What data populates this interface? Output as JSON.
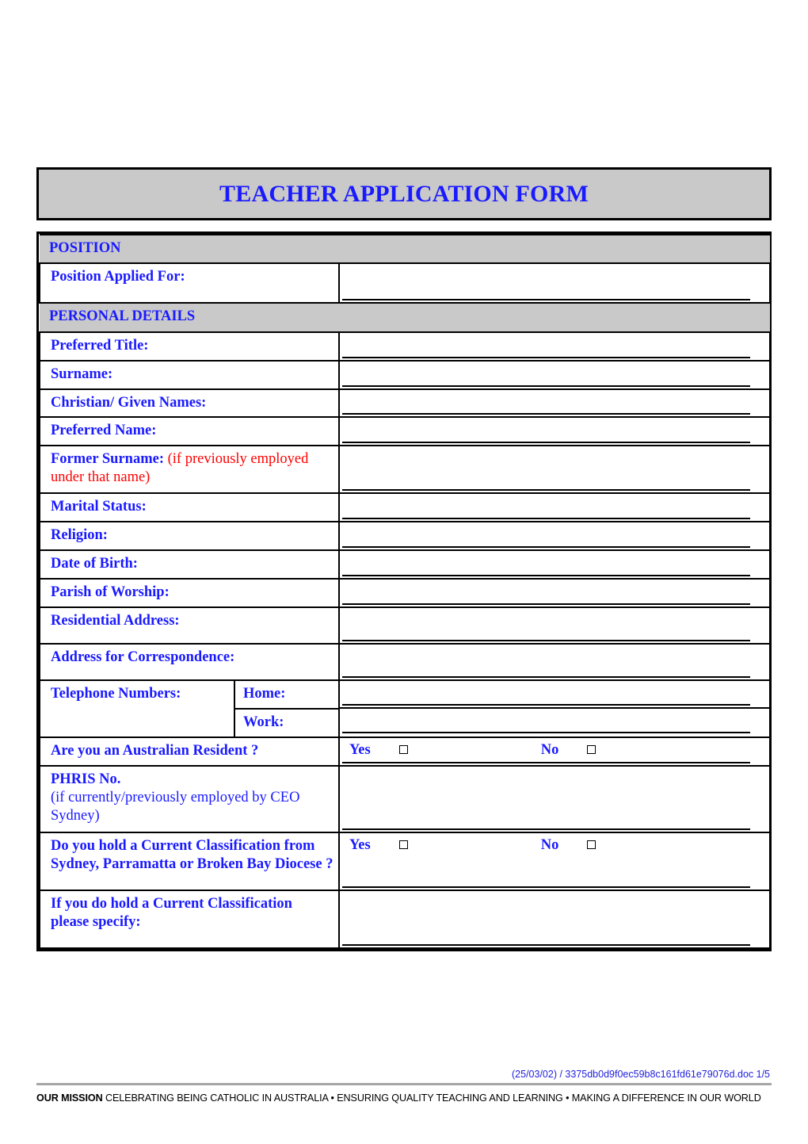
{
  "document": {
    "title": "TEACHER APPLICATION FORM"
  },
  "sections": {
    "position": {
      "band_label": "POSITION",
      "fields": [
        {
          "label": "Position Applied For:",
          "value": ""
        }
      ]
    },
    "personal_details": {
      "band_label": "PERSONAL DETAILS",
      "fields": [
        {
          "label": "Preferred Title:",
          "value": ""
        },
        {
          "label": "Surname:",
          "value": ""
        },
        {
          "label": "Christian/ Given Names:",
          "value": ""
        },
        {
          "label": "Preferred Name:",
          "value": ""
        },
        {
          "label": "Former Surname:",
          "note": "(if previously employed under that name)",
          "value": ""
        },
        {
          "label": "Marital Status:",
          "value": ""
        },
        {
          "label": "Religion:",
          "value": ""
        },
        {
          "label": "Date of Birth:",
          "value": ""
        },
        {
          "label": "Parish of Worship:",
          "value": ""
        },
        {
          "label": "Residential Address:",
          "value": ""
        },
        {
          "label": "Address for Correspondence:",
          "value": ""
        }
      ],
      "telephone": {
        "label": "Telephone Numbers:",
        "rows": [
          {
            "label": "Home:",
            "value": ""
          },
          {
            "label": "Work:",
            "value": ""
          }
        ]
      },
      "australian_resident": {
        "label": "Are you an Australian Resident ?",
        "yes_label": "Yes",
        "no_label": "No",
        "yes_checked": false,
        "no_checked": false
      },
      "phris": {
        "label": "PHRIS No.",
        "note": "(if currently/previously employed by CEO Sydney)",
        "value": ""
      },
      "current_classification": {
        "label": "Do you hold a Current Classification from Sydney, Parramatta or Broken Bay Diocese ?",
        "yes_label": "Yes",
        "no_label": "No",
        "yes_checked": false,
        "no_checked": false
      },
      "classification_specify": {
        "label": "If you do hold a Current Classification please specify:",
        "value": ""
      }
    }
  },
  "footer": {
    "doc_reference": "(25/03/02) / 3375db0d9f0ec59b8c161fd61e79076d.doc  1/5",
    "mission_lead": "OUR MISSION",
    "mission_text": " CELEBRATING BEING CATHOLIC IN AUSTRALIA • ENSURING QUALITY TEACHING AND LEARNING • MAKING A DIFFERENCE IN OUR WORLD"
  },
  "colors": {
    "heading_blue": "#1a1aff",
    "note_red": "#ff0000",
    "band_gray": "#c9c9c9",
    "footer_link_blue": "#2222dd"
  }
}
